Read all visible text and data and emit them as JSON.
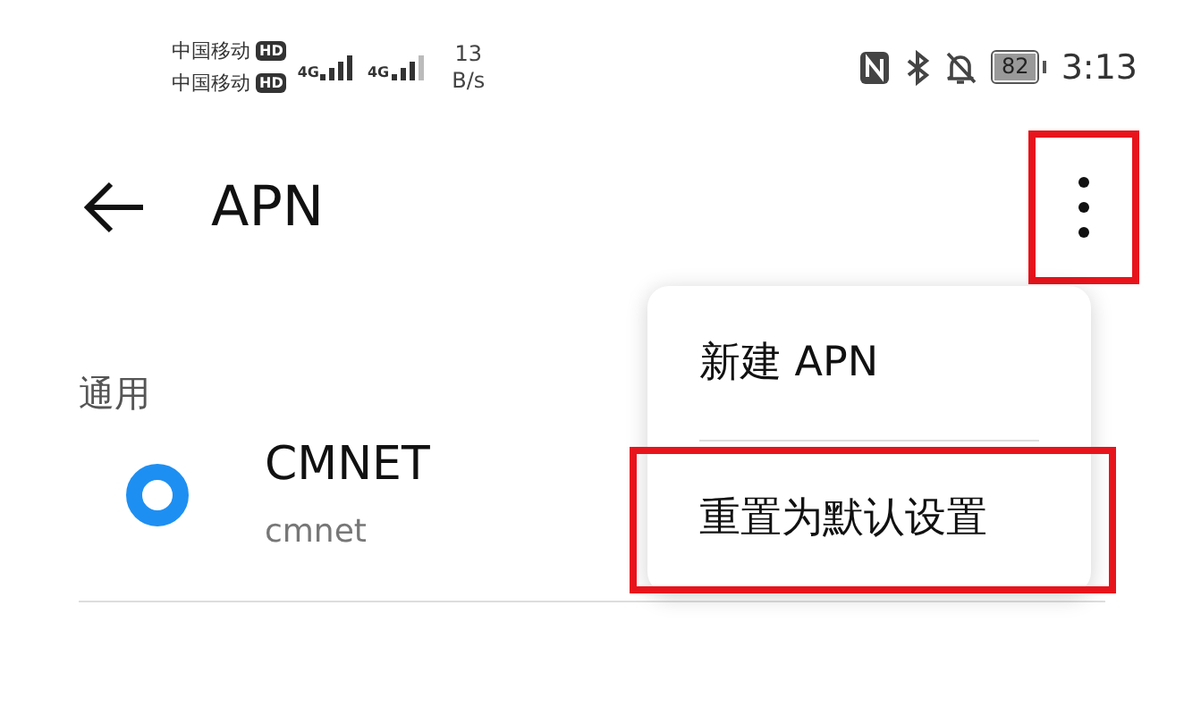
{
  "status_bar": {
    "carriers": [
      {
        "name": "中国移动",
        "badge": "HD"
      },
      {
        "name": "中国移动",
        "badge": "HD"
      }
    ],
    "network_types": [
      "4G",
      "4G"
    ],
    "speed_value": "13",
    "speed_unit": "B/s",
    "battery": "82",
    "time": "3:13"
  },
  "toolbar": {
    "title": "APN",
    "more_highlighted": true
  },
  "section": "通用",
  "apns": [
    {
      "name": "CMNET",
      "apn": "cmnet",
      "selected": true
    }
  ],
  "menu": {
    "items": [
      {
        "label": "新建 APN",
        "highlighted": false
      },
      {
        "label": "重置为默认设置",
        "highlighted": true
      }
    ]
  }
}
